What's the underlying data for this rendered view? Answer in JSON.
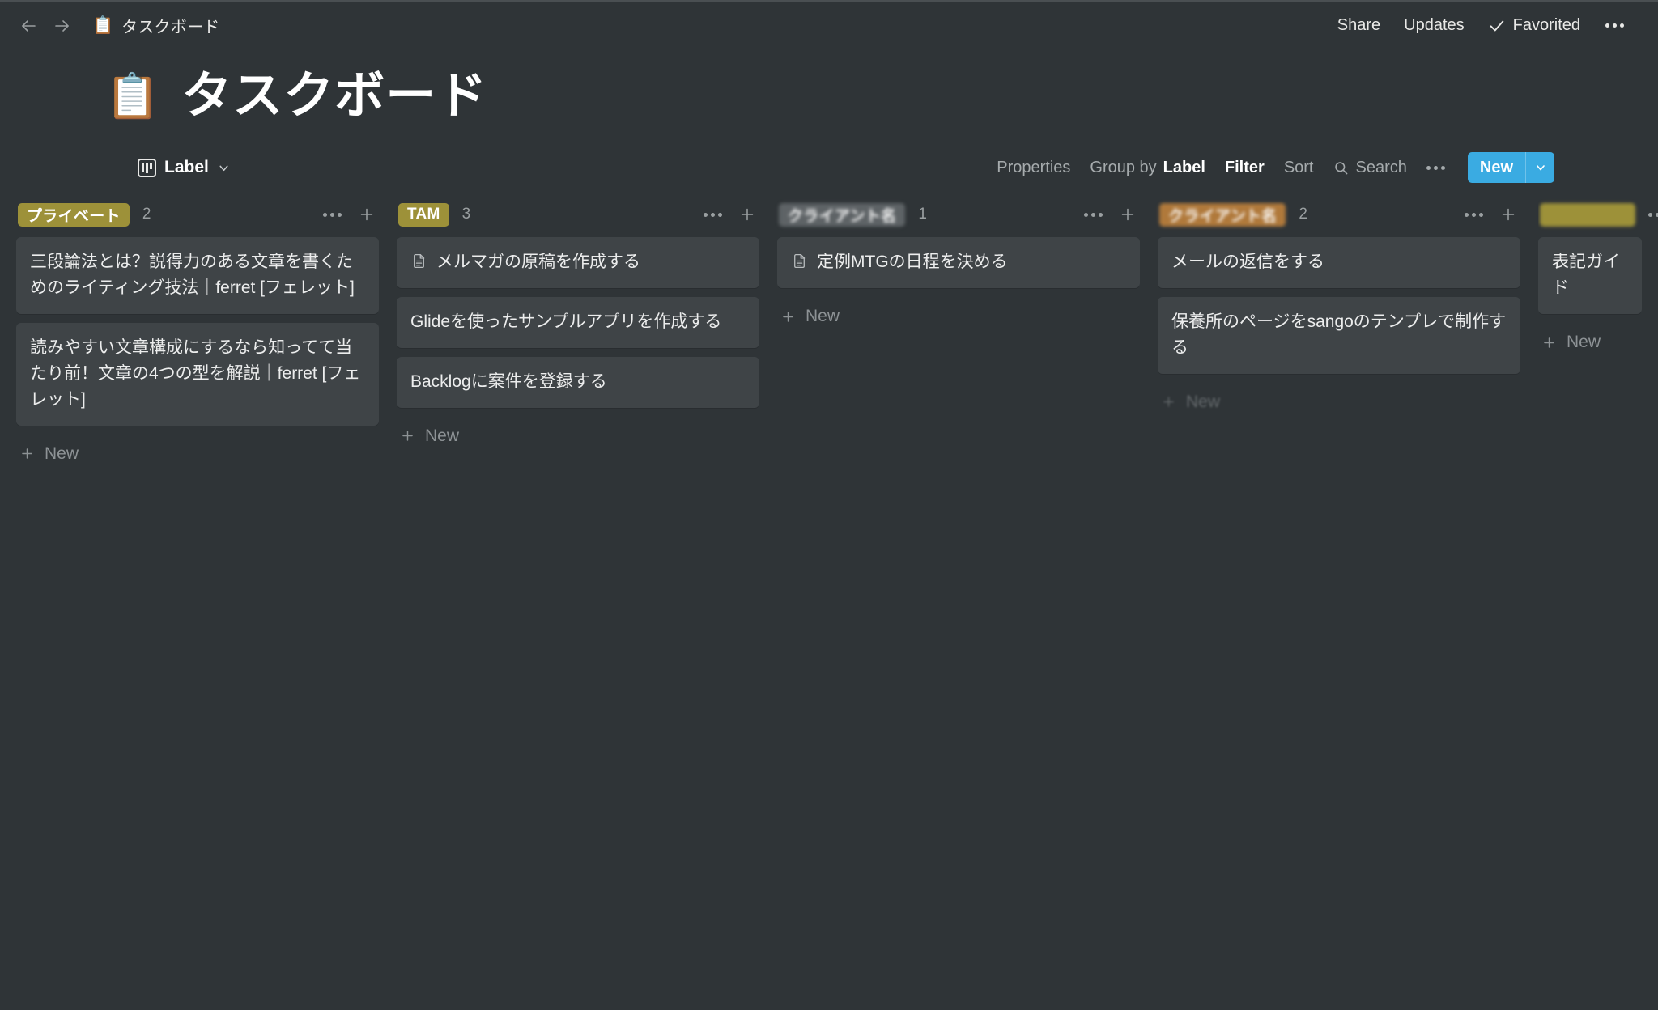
{
  "topbar": {
    "back_icon": "arrow-left-icon",
    "forward_icon": "arrow-right-icon",
    "breadcrumb_emoji": "📋",
    "breadcrumb_title": "タスクボード",
    "share_label": "Share",
    "updates_label": "Updates",
    "favorited_label": "Favorited",
    "more_label": "•••"
  },
  "page": {
    "emoji": "📋",
    "title": "タスクボード"
  },
  "toolbar": {
    "view_label": "Label",
    "properties_label": "Properties",
    "group_by_prefix": "Group by",
    "group_by_value": "Label",
    "filter_label": "Filter",
    "sort_label": "Sort",
    "search_label": "Search",
    "new_label": "New",
    "accent_color": "#3aabe2"
  },
  "board": {
    "new_item_label": "New",
    "columns": [
      {
        "tag": "プライベート",
        "tag_color": "#9d9139",
        "blurred": false,
        "count": "2",
        "cards": [
          {
            "title": "三段論法とは？説得力のある文章を書くためのライティング技法｜ferret [フェレット]",
            "icon": null
          },
          {
            "title": "読みやすい文章構成にするなら知ってて当たり前！文章の4つの型を解説｜ferret [フェレット]",
            "icon": null
          }
        ]
      },
      {
        "tag": "TAM",
        "tag_color": "#9d9139",
        "blurred": false,
        "count": "3",
        "cards": [
          {
            "title": "メルマガの原稿を作成する",
            "icon": "document-icon"
          },
          {
            "title": "Glideを使ったサンプルアプリを作成する",
            "icon": null
          },
          {
            "title": "Backlogに案件を登録する",
            "icon": null
          }
        ]
      },
      {
        "tag": "クライアント名",
        "tag_color": "#5e6366",
        "blurred": true,
        "count": "1",
        "cards": [
          {
            "title": "定例MTGの日程を決める",
            "icon": "document-icon"
          }
        ]
      },
      {
        "tag": "クライアント名",
        "tag_color": "#b0793b",
        "blurred": true,
        "count": "2",
        "cards": [
          {
            "title": "メールの返信をする",
            "icon": null
          },
          {
            "title": "保養所のページをsangoのテンプレで制作する",
            "icon": null
          }
        ]
      },
      {
        "tag": "",
        "tag_color": "#9d9139",
        "blurred": true,
        "count": "",
        "cards": [
          {
            "title": "表記ガイド",
            "icon": null
          }
        ]
      }
    ]
  }
}
